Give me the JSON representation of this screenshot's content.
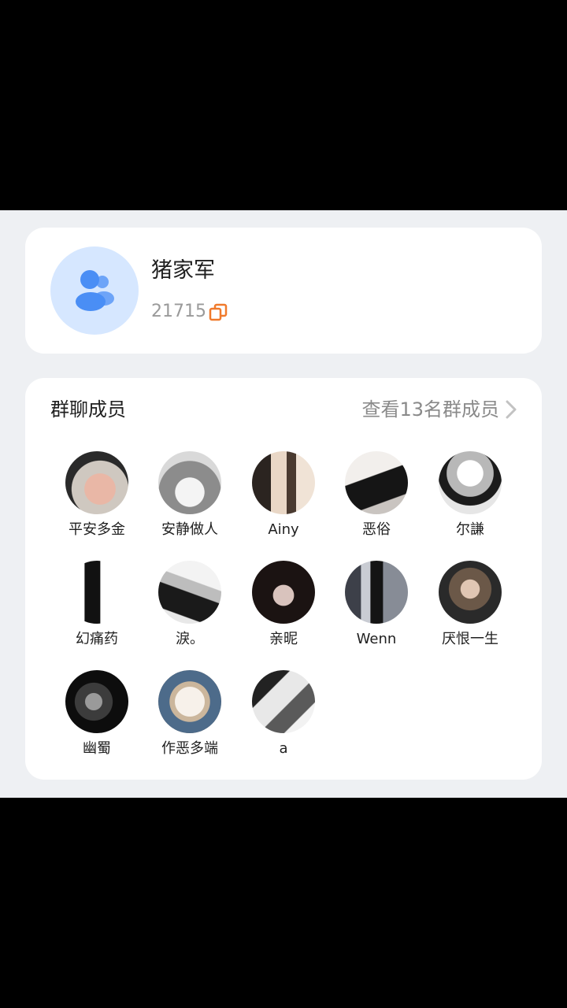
{
  "group": {
    "name": "猪家军",
    "id": "21715"
  },
  "members_section": {
    "title": "群聊成员",
    "view_all": "查看13名群成员"
  },
  "members": [
    {
      "name": "平安多金"
    },
    {
      "name": "安静做人"
    },
    {
      "name": "Ainy"
    },
    {
      "name": "恶俗"
    },
    {
      "name": "尔謙"
    },
    {
      "name": "幻痛药"
    },
    {
      "name": "淚。"
    },
    {
      "name": "亲昵"
    },
    {
      "name": "Wenn"
    },
    {
      "name": "厌恨一生"
    },
    {
      "name": "幽蜀"
    },
    {
      "name": "作恶多端"
    },
    {
      "name": "a"
    }
  ],
  "colors": {
    "group_avatar_bg": "#d6e7ff",
    "group_icon": "#4a8ef5",
    "copy_icon": "#f07a2c",
    "sheet_bg": "#eef0f3"
  },
  "icons": {
    "group_avatar": "group-people-icon",
    "copy": "copy-icon",
    "view_all": "chevron-right-icon"
  }
}
